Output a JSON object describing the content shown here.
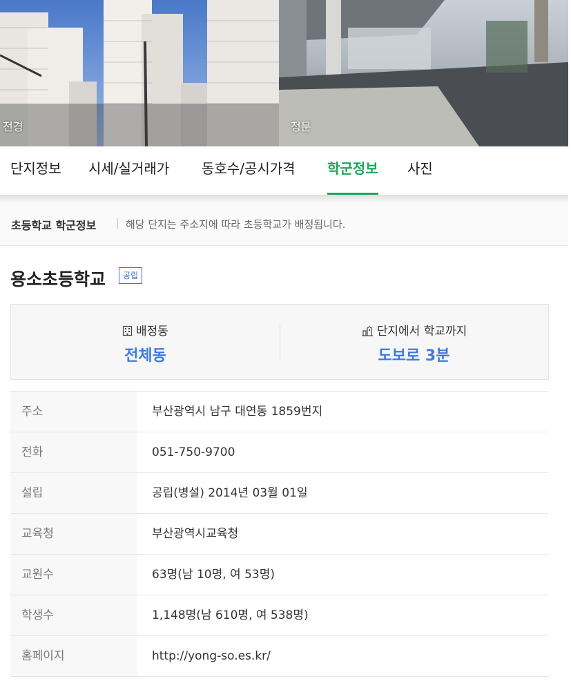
{
  "photos": {
    "left_caption": "전경",
    "right_caption": "정문"
  },
  "tabs": [
    {
      "label": "단지정보",
      "active": false
    },
    {
      "label": "시세/실거래가",
      "active": false
    },
    {
      "label": "동호수/공시가격",
      "active": false
    },
    {
      "label": "학군정보",
      "active": true
    },
    {
      "label": "사진",
      "active": false
    }
  ],
  "notice": {
    "title": "초등학교 학군정보",
    "description": "해당 단지는 주소지에 따라 초등학교가 배정됩니다."
  },
  "school": {
    "name": "용소초등학교",
    "badge": "공립"
  },
  "summary": {
    "assigned_label": "배정동",
    "assigned_value": "전체동",
    "assigned_icon": "building-icon",
    "distance_label": "단지에서 학교까지",
    "distance_value": "도보로 3분",
    "distance_icon": "walking-icon"
  },
  "info_rows": [
    {
      "key": "주소",
      "value": "부산광역시 남구 대연동 1859번지"
    },
    {
      "key": "전화",
      "value": "051-750-9700"
    },
    {
      "key": "설립",
      "value": "공립(병설) 2014년 03월 01일"
    },
    {
      "key": "교육청",
      "value": "부산광역시교육청"
    },
    {
      "key": "교원수",
      "value": "63명(남 10명, 여 53명)"
    },
    {
      "key": "학생수",
      "value": "1,148명(남 610명, 여 538명)"
    },
    {
      "key": "홈페이지",
      "value": "http://yong-so.es.kr/"
    }
  ],
  "colors": {
    "active_tab": "#1ea55a",
    "accent_blue": "#3d7ae0"
  }
}
